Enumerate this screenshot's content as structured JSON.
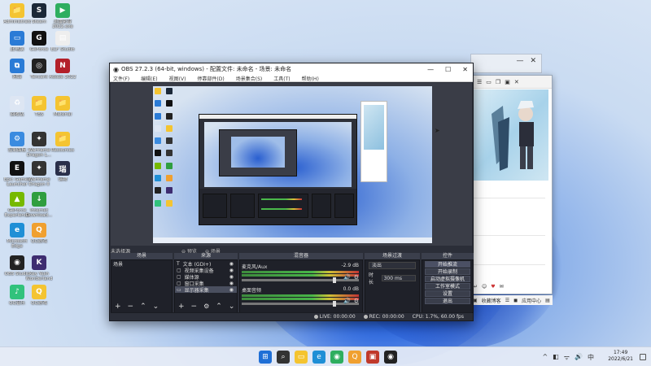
{
  "desktop": {
    "icons": [
      {
        "label": "Administrator",
        "color": "#f4c431",
        "glyph": "📁"
      },
      {
        "label": "Steam",
        "color": "#1b2838",
        "glyph": "S"
      },
      {
        "label": "迅雷影音 2022.exe",
        "color": "#2eae5f",
        "glyph": "▶"
      },
      {
        "label": "此电脑",
        "color": "#2a7bd6",
        "glyph": "▭"
      },
      {
        "label": "GeForce",
        "color": "#111111",
        "glyph": "G"
      },
      {
        "label": "ELF Studio",
        "color": "#eeeeee",
        "glyph": "▤"
      },
      {
        "label": "网络",
        "color": "#2a7bd6",
        "glyph": "⧉"
      },
      {
        "label": "Tencent",
        "color": "#222222",
        "glyph": "◎"
      },
      {
        "label": "Adobe 2022",
        "color": "#b3202a",
        "glyph": "N"
      },
      {
        "label": "回收站",
        "color": "#dde6f3",
        "glyph": "♻"
      },
      {
        "label": "TBS",
        "color": "#f4c431",
        "glyph": "📁"
      },
      {
        "label": "Material",
        "color": "#f4c431",
        "glyph": "📁"
      },
      {
        "label": "控制面板",
        "color": "#3a8be0",
        "glyph": "⚙"
      },
      {
        "label": "Warframe Dragon L...",
        "color": "#333333",
        "glyph": "✦"
      },
      {
        "label": "Resources",
        "color": "#f4c431",
        "glyph": "📁"
      },
      {
        "label": "Epic Games Launcher",
        "color": "#111111",
        "glyph": "E"
      },
      {
        "label": "Warframe Dragon II",
        "color": "#333333",
        "glyph": "✦"
      },
      {
        "label": "瑞物",
        "color": "#2a2f4a",
        "glyph": "瑞"
      },
      {
        "label": "GeForce Experience",
        "color": "#76b900",
        "glyph": "▲"
      },
      {
        "label": "Internet Download...",
        "color": "#2f9e3f",
        "glyph": "↓"
      },
      {
        "label": "Microsoft Edge",
        "color": "#1f8fd6",
        "glyph": "e"
      },
      {
        "label": "QQ游戏",
        "color": "#f0a030",
        "glyph": "Q"
      },
      {
        "label": "OBS Studio",
        "color": "#222222",
        "glyph": "◉"
      },
      {
        "label": "Key Yesh Wonderland",
        "color": "#3d2c70",
        "glyph": "K"
      },
      {
        "label": "QQ音乐",
        "color": "#31c27c",
        "glyph": "♪"
      },
      {
        "label": "QQ游戏",
        "color": "#f4c431",
        "glyph": "Q"
      }
    ]
  },
  "back_window": {
    "toolbar_icons": [
      "☰",
      "▭",
      "❐",
      "▣",
      "✕"
    ],
    "footer": [
      "↵",
      "☺",
      "♥",
      "✉",
      "▣",
      "收藏博客",
      "☰",
      "◼",
      "应用中心",
      "▤"
    ]
  },
  "top_window": {
    "controls": [
      "—",
      "✕"
    ]
  },
  "obs": {
    "title": "OBS 27.2.3 (64-bit, windows) - 配置文件: 未命名 - 场景: 未命名",
    "win_controls": [
      "—",
      "☐",
      "✕"
    ],
    "menu": [
      "文件(F)",
      "编辑(E)",
      "视图(V)",
      "停靠部件(D)",
      "场景集合(S)",
      "工具(T)",
      "帮助(H)"
    ],
    "preview_controls": [
      "⊖ 预览",
      "⊖ 场景"
    ],
    "unsaved_label": "未选择源",
    "docks": {
      "scenes": {
        "title": "场景",
        "items": [
          "场景"
        ]
      },
      "sources": {
        "title": "来源",
        "items": [
          {
            "icon": "T",
            "name": "文本 (GDI+)"
          },
          {
            "icon": "▢",
            "name": "视频采集设备"
          },
          {
            "icon": "▢",
            "name": "媒体源"
          },
          {
            "icon": "▢",
            "name": "窗口采集"
          },
          {
            "icon": "▭",
            "name": "显示器采集"
          }
        ]
      },
      "mixer": {
        "title": "混音器",
        "channels": [
          {
            "name": "麦克风/Aux",
            "db": "-2.9 dB"
          },
          {
            "name": "桌面音频",
            "db": "0.0 dB"
          }
        ]
      },
      "transitions": {
        "title": "场景过渡",
        "type": "淡出",
        "duration_label": "时长",
        "duration_value": "300 ms"
      },
      "controls": {
        "title": "控件",
        "buttons": [
          "开始推流",
          "开始录制",
          "启动虚拟摄像机",
          "工作室模式",
          "设置",
          "退出"
        ]
      }
    },
    "status": {
      "live": "LIVE: 00:00:00",
      "rec": "REC: 00:00:00",
      "cpu": "CPU: 1.7%, 60.00 fps"
    }
  },
  "taskbar": {
    "icons": [
      {
        "glyph": "⊞",
        "color": "#1f6fd6"
      },
      {
        "glyph": "⌕",
        "color": "#333333"
      },
      {
        "glyph": "▭",
        "color": "#f4c431"
      },
      {
        "glyph": "e",
        "color": "#1f8fd6"
      },
      {
        "glyph": "◉",
        "color": "#2eae5f"
      },
      {
        "glyph": "Q",
        "color": "#f0a030"
      },
      {
        "glyph": "▣",
        "color": "#c0392b"
      },
      {
        "glyph": "◉",
        "color": "#222222"
      }
    ],
    "tray": [
      "^",
      "◧",
      "ᯤ",
      "🔊",
      "中"
    ],
    "time": "17:49",
    "date": "2022/6/21"
  }
}
